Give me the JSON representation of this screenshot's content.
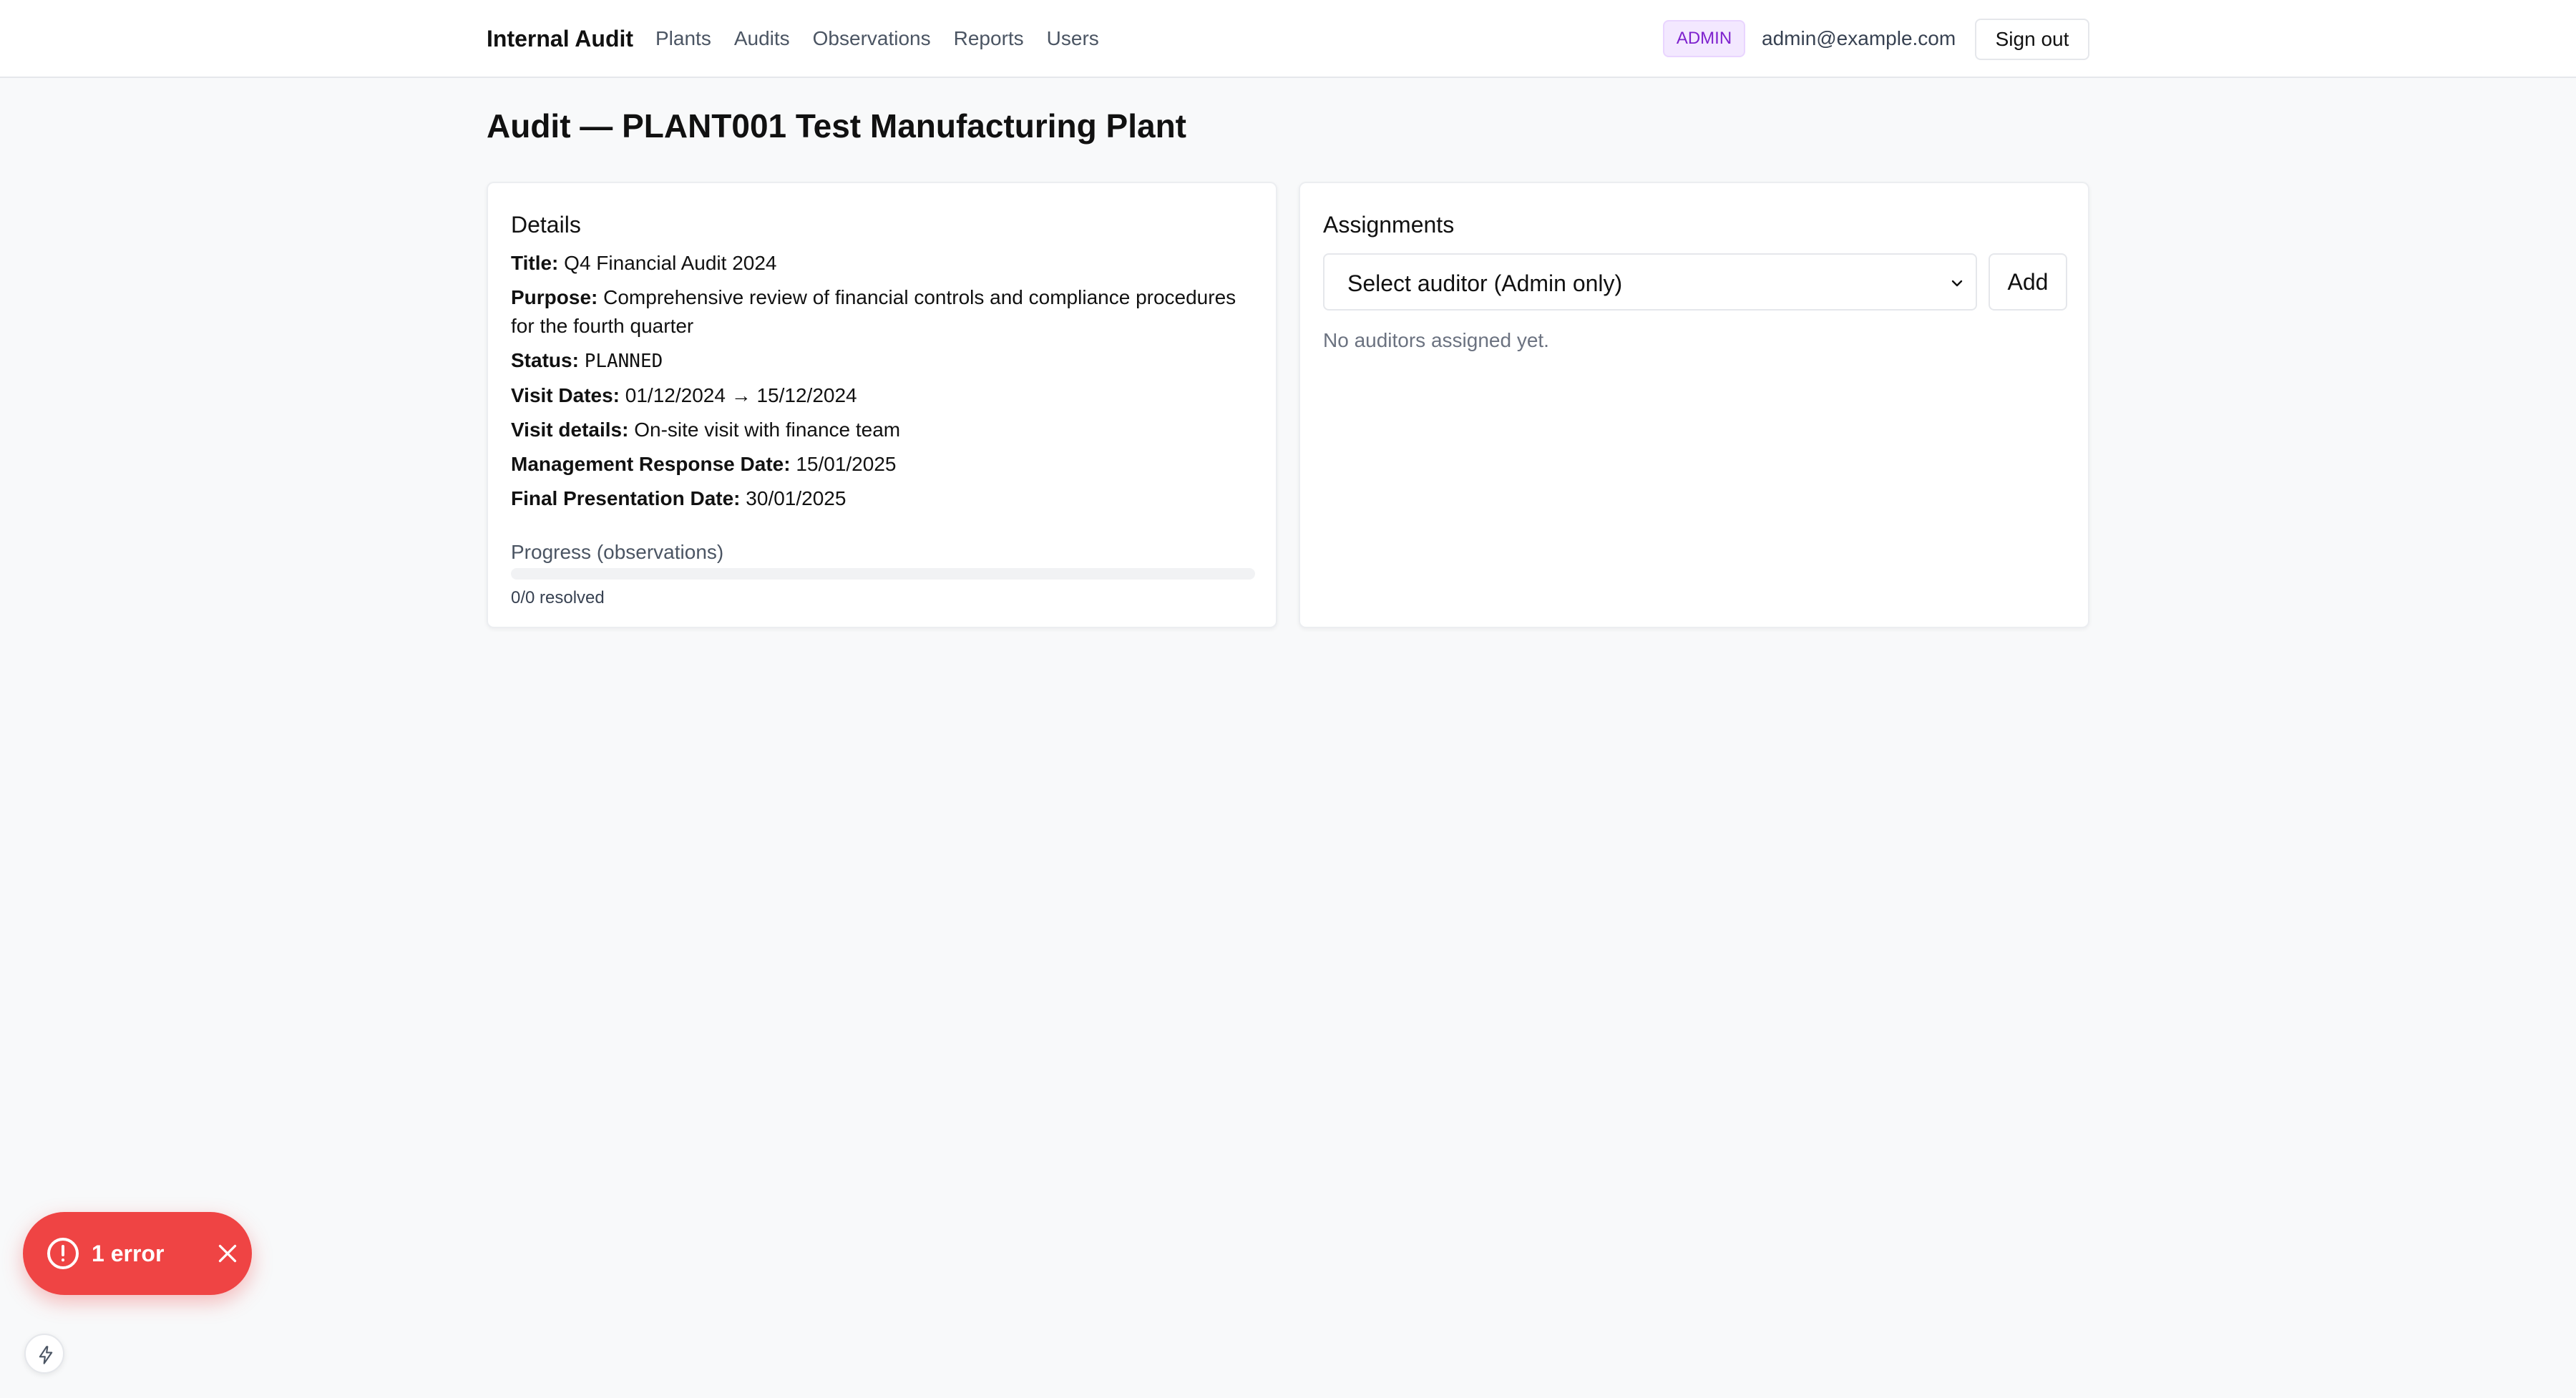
{
  "nav": {
    "brand": "Internal Audit",
    "links": [
      "Plants",
      "Audits",
      "Observations",
      "Reports",
      "Users"
    ],
    "role_badge": "ADMIN",
    "user_email": "admin@example.com",
    "signout_label": "Sign out"
  },
  "page": {
    "title": "Audit — PLANT001 Test Manufacturing Plant"
  },
  "details": {
    "heading": "Details",
    "title_label": "Title:",
    "title_value": "Q4 Financial Audit 2024",
    "purpose_label": "Purpose:",
    "purpose_value": "Comprehensive review of financial controls and compliance procedures for the fourth quarter",
    "status_label": "Status:",
    "status_value": "PLANNED",
    "visit_dates_label": "Visit Dates:",
    "visit_dates_value": "01/12/2024 → 15/12/2024",
    "visit_details_label": "Visit details:",
    "visit_details_value": "On-site visit with finance team",
    "mgmt_response_label": "Management Response Date:",
    "mgmt_response_value": "15/01/2025",
    "final_presentation_label": "Final Presentation Date:",
    "final_presentation_value": "30/01/2025",
    "progress_label": "Progress (observations)",
    "progress_fraction": 0,
    "progress_count": "0/0 resolved"
  },
  "assignments": {
    "heading": "Assignments",
    "select_value": "Select auditor (Admin only)",
    "add_label": "Add",
    "empty_text": "No auditors assigned yet."
  },
  "error_toast": {
    "text": "1 error"
  },
  "icons": {
    "error": "alert-circle-icon",
    "close": "close-icon",
    "dev": "lightning-bolt-icon",
    "select": "chevron-down-icon"
  },
  "colors": {
    "error_red": "#ef4444",
    "badge_purple": "#7e22ce",
    "badge_bg": "#f3e8ff",
    "page_bg": "#f8f9fa"
  }
}
